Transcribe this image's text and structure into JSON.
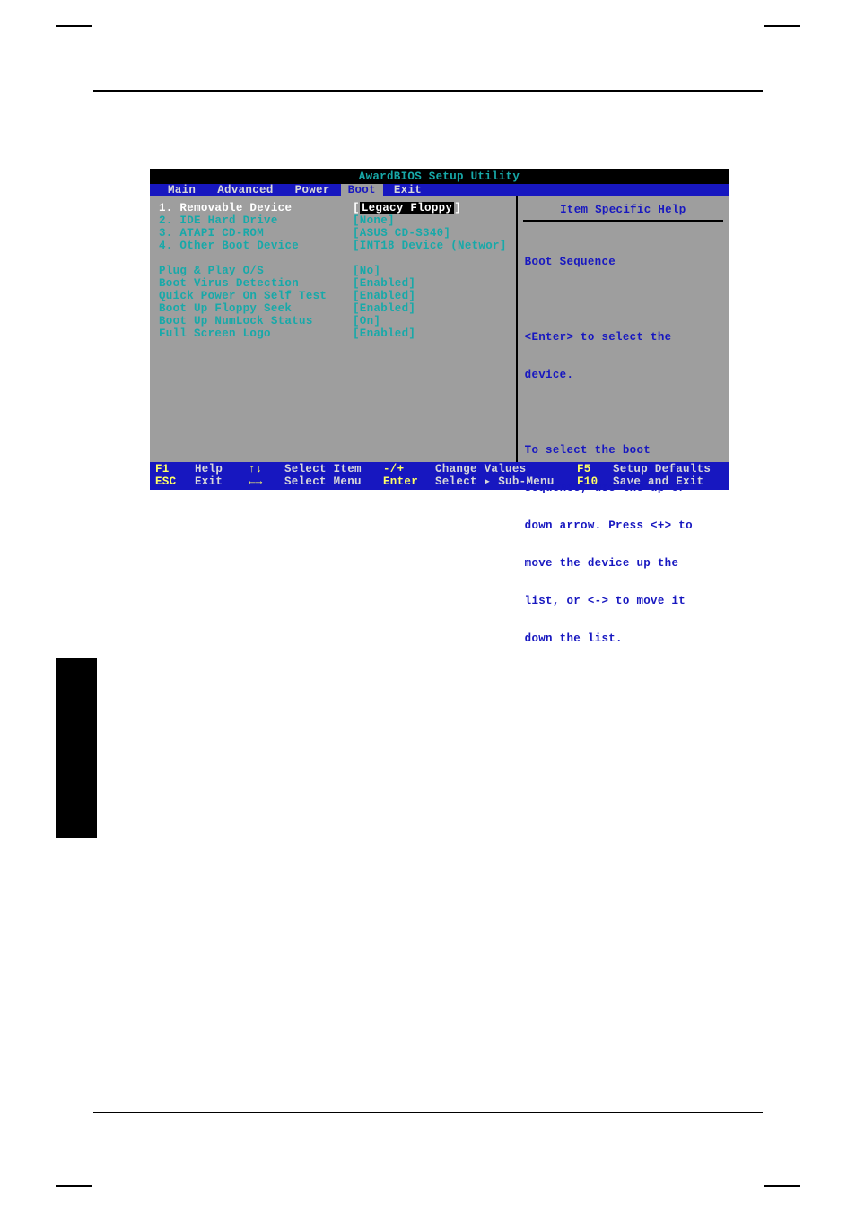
{
  "bios": {
    "title": "AwardBIOS Setup Utility",
    "menu": {
      "items": [
        "Main",
        "Advanced",
        "Power",
        "Boot",
        "Exit"
      ],
      "active_index": 3
    },
    "boot_seq": [
      {
        "n": "1.",
        "label": "Removable Device",
        "value": "Legacy Floppy",
        "selected": true
      },
      {
        "n": "2.",
        "label": "IDE Hard Drive",
        "value": "[None]",
        "selected": false
      },
      {
        "n": "3.",
        "label": "ATAPI CD-ROM",
        "value": "[ASUS CD-S340]",
        "selected": false
      },
      {
        "n": "4.",
        "label": "Other Boot Device",
        "value": "[INT18 Device (Networ]",
        "selected": false
      }
    ],
    "settings": [
      {
        "label": "Plug & Play O/S",
        "value": "[No]"
      },
      {
        "label": "Boot Virus Detection",
        "value": "[Enabled]"
      },
      {
        "label": "Quick Power On Self Test",
        "value": "[Enabled]"
      },
      {
        "label": "Boot Up Floppy Seek",
        "value": "[Enabled]"
      },
      {
        "label": "Boot Up NumLock Status",
        "value": "[On]"
      },
      {
        "label": "Full Screen Logo",
        "value": "[Enabled]"
      }
    ],
    "help": {
      "title": "Item Specific Help",
      "subject": "Boot Sequence",
      "line1": "<Enter> to select the",
      "line2": "device.",
      "line3": "To select the boot",
      "line4": "sequence, use the up or",
      "line5": "down arrow. Press <+> to",
      "line6": "move the device up the",
      "line7": "list, or <-> to move it",
      "line8": "down the list."
    },
    "footer": {
      "r1": {
        "k1": "F1",
        "t1": "Help",
        "k2": "↑↓",
        "t2": "Select Item",
        "k3": "-/+",
        "t3": "Change Values",
        "k4": "F5",
        "t4": "Setup Defaults"
      },
      "r2": {
        "k1": "ESC",
        "t1": "Exit",
        "k2": "←→",
        "t2": "Select Menu",
        "k3": "Enter",
        "t3": "Select ▸ Sub-Menu",
        "k4": "F10",
        "t4": "Save and Exit"
      }
    }
  }
}
